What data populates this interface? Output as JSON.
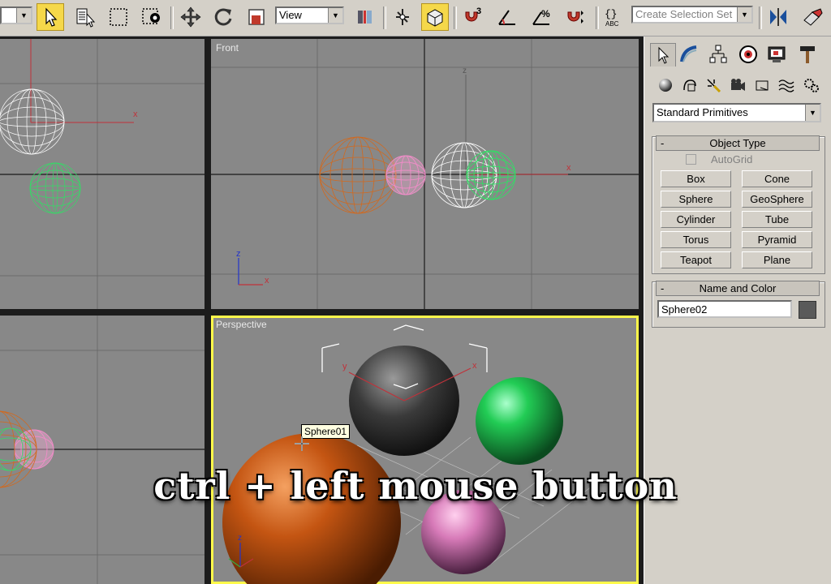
{
  "toolbar": {
    "reference_coord": "View",
    "selection_set_placeholder": "Create Selection Set",
    "icons": [
      "select-icon",
      "select-by-name-icon",
      "rectangle-region-icon",
      "window-crossing-icon",
      "move-icon",
      "rotate-icon",
      "scale-icon",
      "view-coord-dropdown",
      "pivot-icon",
      "manipulate-icon",
      "snap-3d-icon",
      "angle-snap-icon",
      "percent-snap-icon",
      "spinner-snap-icon",
      "edit-named-selection-icon",
      "mirror-icon",
      "align-icon"
    ],
    "snap_labels": {
      "snap": "3",
      "percent": "%"
    }
  },
  "viewports": {
    "top_left": {
      "label": ""
    },
    "front": {
      "label": "Front"
    },
    "bottom_left": {
      "label": ""
    },
    "perspective": {
      "label": "Perspective"
    }
  },
  "axis_labels": {
    "x": "x",
    "y": "y",
    "z": "z"
  },
  "tooltip": "Sphere01",
  "caption": "ctrl + left mouse button",
  "command_panel": {
    "tabs": [
      "create-tab",
      "modify-tab",
      "hierarchy-tab",
      "motion-tab",
      "display-tab",
      "utilities-tab"
    ],
    "subtabs": [
      "geometry-icon",
      "shapes-icon",
      "lights-icon",
      "cameras-icon",
      "helpers-icon",
      "space-warps-icon",
      "systems-icon"
    ],
    "category": "Standard Primitives",
    "object_type": {
      "title": "Object Type",
      "collapse": "-",
      "autogrid": "AutoGrid",
      "buttons": [
        "Box",
        "Cone",
        "Sphere",
        "GeoSphere",
        "Cylinder",
        "Tube",
        "Torus",
        "Pyramid",
        "Teapot",
        "Plane"
      ]
    },
    "name_and_color": {
      "title": "Name and Color",
      "collapse": "-",
      "name_value": "Sphere02",
      "color": "#5a5a5a"
    }
  },
  "colors": {
    "viewport_bg": "#888888",
    "grid": "#6b6b6b",
    "grid_axis": "#1a1a1a",
    "selected_border": "#fff94a",
    "sphere_orange": "#d2691e",
    "sphere_pink": "#f08cc8",
    "sphere_white": "#ffffff",
    "sphere_green": "#33dd66"
  }
}
